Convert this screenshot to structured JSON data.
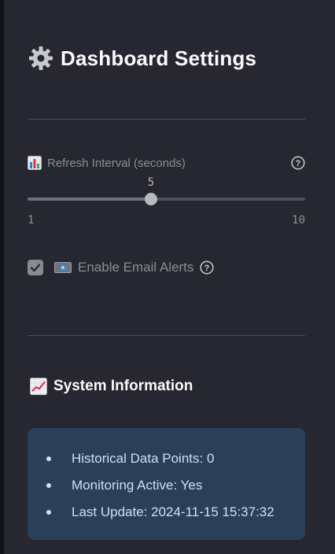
{
  "sidebar": {
    "title": "Dashboard Settings",
    "title_icon": "gear-icon",
    "refresh_slider": {
      "icon": "bar-chart-icon",
      "label": "Refresh Interval (seconds)",
      "value": "5",
      "min": "1",
      "max": "10",
      "fraction": 0.444
    },
    "email_alerts": {
      "icon": "email-icon",
      "label": "Enable Email Alerts",
      "checked": true
    },
    "system_info": {
      "icon": "chart-increasing-icon",
      "title": "System Information",
      "items": [
        {
          "text": "Historical Data Points: 0"
        },
        {
          "text": "Monitoring Active: Yes"
        },
        {
          "text": "Last Update: 2024-11-15 15:37:32"
        }
      ]
    }
  },
  "colors": {
    "sidebar_bg": "#262730",
    "info_box_bg": "#2b3f59",
    "info_text": "#c7e2fb",
    "muted_text": "#8c8d94"
  }
}
